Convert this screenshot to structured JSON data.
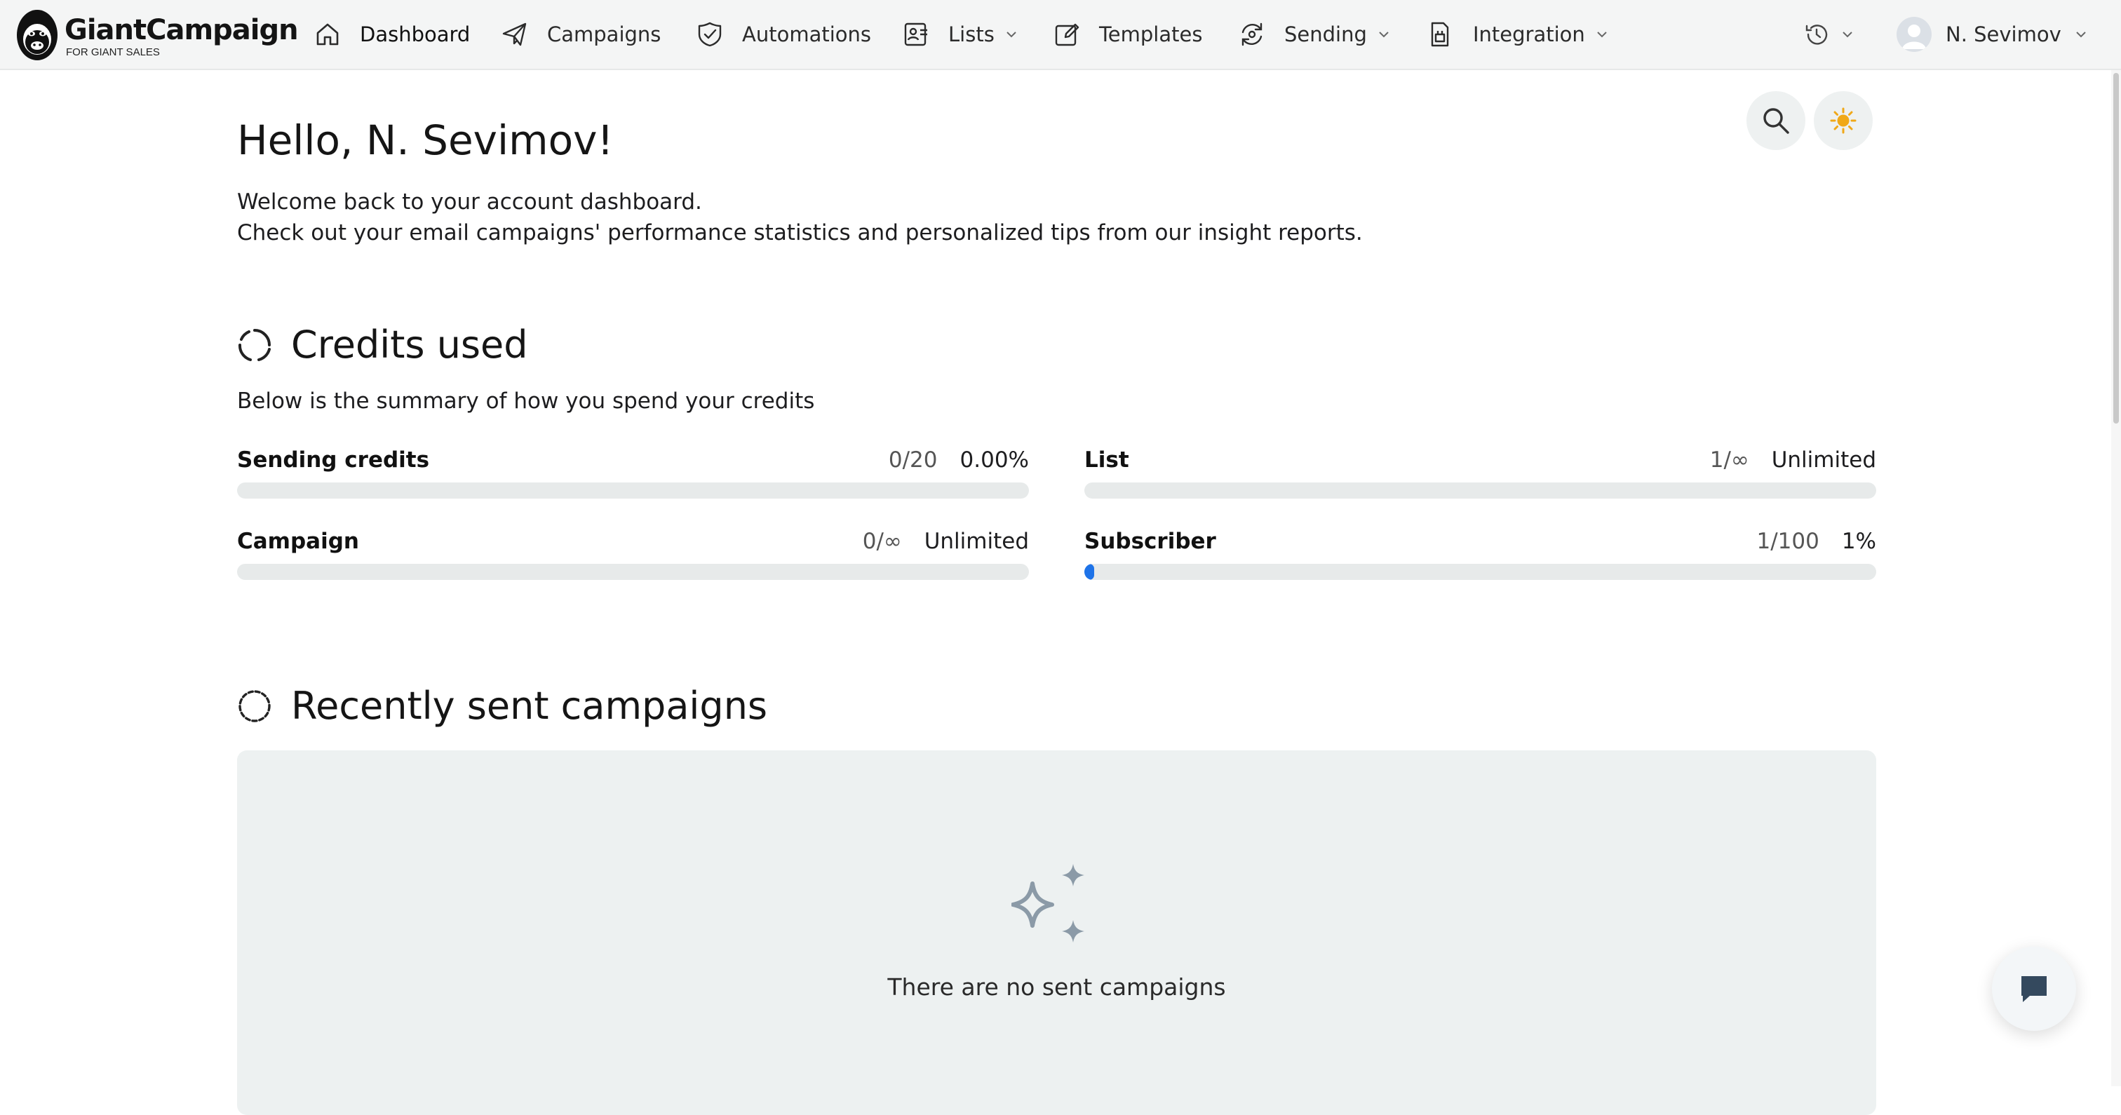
{
  "brand": {
    "name": "GiantCampaign",
    "tagline": "FOR GIANT SALES"
  },
  "nav": {
    "dashboard": "Dashboard",
    "campaigns": "Campaigns",
    "automations": "Automations",
    "lists": "Lists",
    "templates": "Templates",
    "sending": "Sending",
    "integration": "Integration",
    "user": "N. Sevimov"
  },
  "page": {
    "greeting": "Hello, N. Sevimov!",
    "intro_line1": "Welcome back to your account dashboard.",
    "intro_line2": "Check out your email campaigns' performance statistics and personalized tips from our insight reports."
  },
  "credits": {
    "title": "Credits used",
    "subtitle": "Below is the summary of how you spend your credits",
    "items": [
      {
        "label": "Sending credits",
        "used": "0/20",
        "percent_text": "0.00%",
        "fill_fraction": 0
      },
      {
        "label": "List",
        "used": "1/∞",
        "percent_text": "Unlimited",
        "fill_fraction": 0
      },
      {
        "label": "Campaign",
        "used": "0/∞",
        "percent_text": "Unlimited",
        "fill_fraction": 0
      },
      {
        "label": "Subscriber",
        "used": "1/100",
        "percent_text": "1%",
        "fill_fraction": 0.01
      }
    ]
  },
  "recent": {
    "title": "Recently sent campaigns",
    "empty_message": "There are no sent campaigns"
  },
  "colors": {
    "accent": "#1e73e8",
    "panel": "#edf1f1",
    "sun": "#f0a818"
  }
}
